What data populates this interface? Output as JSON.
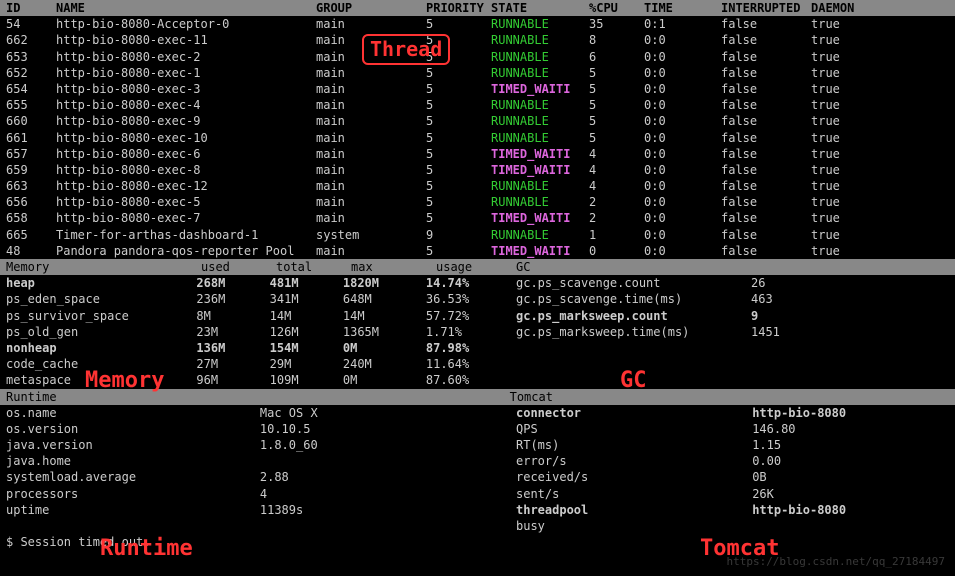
{
  "thread_headers": {
    "id": "ID",
    "name": "NAME",
    "group": "GROUP",
    "priority": "PRIORITY",
    "state": "STATE",
    "cpu": "%CPU",
    "time": "TIME",
    "intr": "INTERRUPTED",
    "daemon": "DAEMON"
  },
  "threads": [
    {
      "id": "54",
      "name": "http-bio-8080-Acceptor-0",
      "group": "main",
      "priority": "5",
      "state": "RUNNABLE",
      "cpu": "35",
      "time": "0:1",
      "intr": "false",
      "daemon": "true"
    },
    {
      "id": "662",
      "name": "http-bio-8080-exec-11",
      "group": "main",
      "priority": "5",
      "state": "RUNNABLE",
      "cpu": "8",
      "time": "0:0",
      "intr": "false",
      "daemon": "true"
    },
    {
      "id": "653",
      "name": "http-bio-8080-exec-2",
      "group": "main",
      "priority": "5",
      "state": "RUNNABLE",
      "cpu": "6",
      "time": "0:0",
      "intr": "false",
      "daemon": "true"
    },
    {
      "id": "652",
      "name": "http-bio-8080-exec-1",
      "group": "main",
      "priority": "5",
      "state": "RUNNABLE",
      "cpu": "5",
      "time": "0:0",
      "intr": "false",
      "daemon": "true"
    },
    {
      "id": "654",
      "name": "http-bio-8080-exec-3",
      "group": "main",
      "priority": "5",
      "state": "TIMED_WAITI",
      "cpu": "5",
      "time": "0:0",
      "intr": "false",
      "daemon": "true"
    },
    {
      "id": "655",
      "name": "http-bio-8080-exec-4",
      "group": "main",
      "priority": "5",
      "state": "RUNNABLE",
      "cpu": "5",
      "time": "0:0",
      "intr": "false",
      "daemon": "true"
    },
    {
      "id": "660",
      "name": "http-bio-8080-exec-9",
      "group": "main",
      "priority": "5",
      "state": "RUNNABLE",
      "cpu": "5",
      "time": "0:0",
      "intr": "false",
      "daemon": "true"
    },
    {
      "id": "661",
      "name": "http-bio-8080-exec-10",
      "group": "main",
      "priority": "5",
      "state": "RUNNABLE",
      "cpu": "5",
      "time": "0:0",
      "intr": "false",
      "daemon": "true"
    },
    {
      "id": "657",
      "name": "http-bio-8080-exec-6",
      "group": "main",
      "priority": "5",
      "state": "TIMED_WAITI",
      "cpu": "4",
      "time": "0:0",
      "intr": "false",
      "daemon": "true"
    },
    {
      "id": "659",
      "name": "http-bio-8080-exec-8",
      "group": "main",
      "priority": "5",
      "state": "TIMED_WAITI",
      "cpu": "4",
      "time": "0:0",
      "intr": "false",
      "daemon": "true"
    },
    {
      "id": "663",
      "name": "http-bio-8080-exec-12",
      "group": "main",
      "priority": "5",
      "state": "RUNNABLE",
      "cpu": "4",
      "time": "0:0",
      "intr": "false",
      "daemon": "true"
    },
    {
      "id": "656",
      "name": "http-bio-8080-exec-5",
      "group": "main",
      "priority": "5",
      "state": "RUNNABLE",
      "cpu": "2",
      "time": "0:0",
      "intr": "false",
      "daemon": "true"
    },
    {
      "id": "658",
      "name": "http-bio-8080-exec-7",
      "group": "main",
      "priority": "5",
      "state": "TIMED_WAITI",
      "cpu": "2",
      "time": "0:0",
      "intr": "false",
      "daemon": "true"
    },
    {
      "id": "665",
      "name": "Timer-for-arthas-dashboard-1",
      "group": "system",
      "priority": "9",
      "state": "RUNNABLE",
      "cpu": "1",
      "time": "0:0",
      "intr": "false",
      "daemon": "true"
    },
    {
      "id": "48",
      "name": "Pandora pandora-qos-reporter Pool",
      "group": "main",
      "priority": "5",
      "state": "TIMED_WAITI",
      "cpu": "0",
      "time": "0:0",
      "intr": "false",
      "daemon": "true"
    }
  ],
  "mem_headers": {
    "title": "Memory",
    "used": "used",
    "total": "total",
    "max": "max",
    "usage": "usage",
    "gc": "GC"
  },
  "memory": [
    {
      "name": "heap",
      "used": "268M",
      "total": "481M",
      "max": "1820M",
      "usage": "14.74%",
      "bold": true
    },
    {
      "name": "ps_eden_space",
      "used": "236M",
      "total": "341M",
      "max": "648M",
      "usage": "36.53%"
    },
    {
      "name": "ps_survivor_space",
      "used": "8M",
      "total": "14M",
      "max": "14M",
      "usage": "57.72%"
    },
    {
      "name": "ps_old_gen",
      "used": "23M",
      "total": "126M",
      "max": "1365M",
      "usage": "1.71%"
    },
    {
      "name": "nonheap",
      "used": "136M",
      "total": "154M",
      "max": "0M",
      "usage": "87.98%",
      "bold": true
    },
    {
      "name": "code_cache",
      "used": "27M",
      "total": "29M",
      "max": "240M",
      "usage": "11.64%"
    },
    {
      "name": "metaspace",
      "used": "96M",
      "total": "109M",
      "max": "0M",
      "usage": "87.60%"
    }
  ],
  "gc": [
    {
      "name": "gc.ps_scavenge.count",
      "val": "26"
    },
    {
      "name": "gc.ps_scavenge.time(ms)",
      "val": "463"
    },
    {
      "name": "gc.ps_marksweep.count",
      "val": "9",
      "bold": true
    },
    {
      "name": "gc.ps_marksweep.time(ms)",
      "val": "1451"
    }
  ],
  "rt_header": {
    "left": "Runtime",
    "right": "Tomcat"
  },
  "runtime": [
    {
      "name": "os.name",
      "val": "Mac OS X"
    },
    {
      "name": "os.version",
      "val": "10.10.5"
    },
    {
      "name": "java.version",
      "val": "1.8.0_60"
    },
    {
      "name": "java.home",
      "val": ""
    },
    {
      "name": "",
      "val": ""
    },
    {
      "name": "systemload.average",
      "val": "2.88"
    },
    {
      "name": "processors",
      "val": "4"
    },
    {
      "name": "uptime",
      "val": "11389s"
    }
  ],
  "tomcat": [
    {
      "name": "connector",
      "val": "http-bio-8080",
      "bold": true
    },
    {
      "name": "QPS",
      "val": "146.80"
    },
    {
      "name": "RT(ms)",
      "val": "1.15"
    },
    {
      "name": "error/s",
      "val": "0.00"
    },
    {
      "name": "received/s",
      "val": "0B"
    },
    {
      "name": "sent/s",
      "val": "26K"
    },
    {
      "name": "threadpool",
      "val": "http-bio-8080",
      "bold": true
    },
    {
      "name": "busy",
      "val": ""
    }
  ],
  "overlays": {
    "thread": "Thread",
    "memory": "Memory",
    "gc": "GC",
    "runtime": "Runtime",
    "tomcat": "Tomcat"
  },
  "prompt": "$ Session timed out.",
  "watermark": "https://blog.csdn.net/qq_27184497"
}
